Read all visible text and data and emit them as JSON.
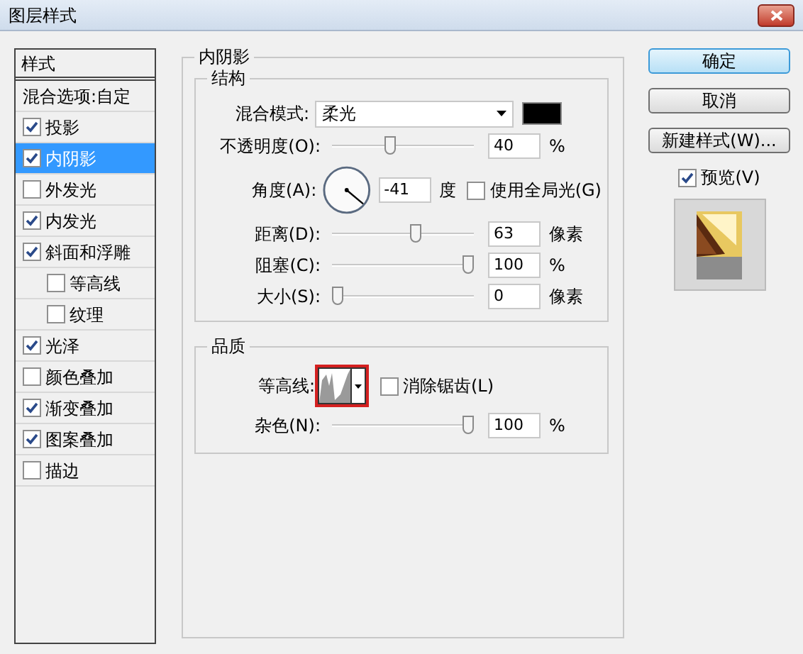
{
  "window": {
    "title": "图层样式"
  },
  "sidebar": {
    "header": "样式",
    "items": [
      {
        "label": "混合选项:自定",
        "kind": "plain",
        "selected": false
      },
      {
        "label": "投影",
        "kind": "check",
        "checked": true,
        "selected": false
      },
      {
        "label": "内阴影",
        "kind": "check",
        "checked": true,
        "selected": true
      },
      {
        "label": "外发光",
        "kind": "check",
        "checked": false,
        "selected": false
      },
      {
        "label": "内发光",
        "kind": "check",
        "checked": true,
        "selected": false
      },
      {
        "label": "斜面和浮雕",
        "kind": "check",
        "checked": true,
        "selected": false,
        "children": [
          {
            "label": "等高线",
            "kind": "check",
            "checked": false,
            "selected": false
          },
          {
            "label": "纹理",
            "kind": "check",
            "checked": false,
            "selected": false
          }
        ]
      },
      {
        "label": "光泽",
        "kind": "check",
        "checked": true,
        "selected": false
      },
      {
        "label": "颜色叠加",
        "kind": "check",
        "checked": false,
        "selected": false
      },
      {
        "label": "渐变叠加",
        "kind": "check",
        "checked": true,
        "selected": false
      },
      {
        "label": "图案叠加",
        "kind": "check",
        "checked": true,
        "selected": false
      },
      {
        "label": "描边",
        "kind": "check",
        "checked": false,
        "selected": false
      }
    ]
  },
  "panel": {
    "title": "内阴影",
    "structure": {
      "title": "结构",
      "blend_mode": {
        "label": "混合模式:",
        "value": "柔光",
        "color": "#000000"
      },
      "opacity": {
        "label": "不透明度(O):",
        "level": 0.4,
        "value": "40",
        "unit": "%"
      },
      "angle": {
        "label": "角度(A):",
        "value": "-41",
        "unit": "度",
        "global_light": {
          "label": "使用全局光(G)",
          "checked": false
        }
      },
      "sliders": [
        {
          "label": "距离(D):",
          "level": 0.6,
          "value": "63",
          "unit": "像素"
        },
        {
          "label": "阻塞(C):",
          "level": 1,
          "value": "100",
          "unit": "%"
        },
        {
          "label": "大小(S):",
          "level": 0,
          "value": "0",
          "unit": "像素"
        }
      ]
    },
    "quality": {
      "title": "品质",
      "contour": {
        "label": "等高线:",
        "highlighted": true
      },
      "anti_alias": {
        "label": "消除锯齿(L)",
        "checked": false
      },
      "noise": {
        "label": "杂色(N):",
        "level": 1,
        "value": "100",
        "unit": "%"
      }
    }
  },
  "buttons": [
    {
      "label": "确定",
      "default": true
    },
    {
      "label": "取消",
      "default": false
    },
    {
      "label": "新建样式(W)...",
      "default": false
    }
  ],
  "preview": {
    "label": "预览(V)",
    "checked": true
  }
}
